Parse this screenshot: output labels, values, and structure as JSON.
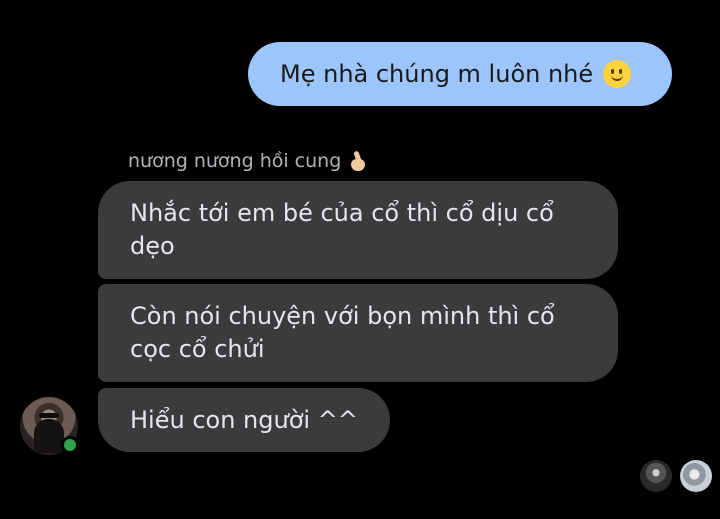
{
  "conversation": {
    "outgoing": [
      {
        "text": "Mẹ nhà chúng m luôn nhé",
        "emoji": "slightly-smiling-face-emoji",
        "color": "#9cc5fb"
      }
    ],
    "incoming": {
      "sender_name": "nương nương hồi cung",
      "sender_emoji": "finger-heart-hand-emoji",
      "bubble_color": "#3a3b3c",
      "messages": [
        {
          "text": "Nhắc tới em bé của cổ thì cổ dịu cổ dẹo"
        },
        {
          "text": "Còn nói chuyện với bọn mình thì cổ cọc cổ chửi"
        },
        {
          "text": "Hiểu con người ^^"
        }
      ],
      "avatar": "sender-avatar",
      "online_status_color": "#31a24c"
    },
    "read_receipts": [
      "seen-by-avatar-1",
      "seen-by-avatar-2"
    ]
  }
}
